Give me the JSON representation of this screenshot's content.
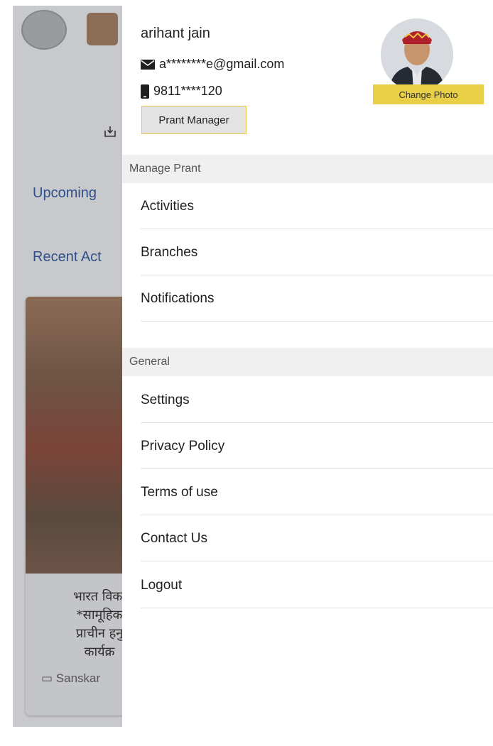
{
  "background": {
    "upcoming_label": "Upcoming",
    "recent_label": "Recent Act",
    "card_text": "भारत विका\n*सामूहिक\nप्राचीन हनु\nकार्यक्र",
    "card_meta": "Sanskar"
  },
  "drawer": {
    "profile": {
      "name": "arihant jain",
      "email": "a********e@gmail.com",
      "phone": "9811****120",
      "role_button": "Prant Manager",
      "change_photo": "Change Photo"
    },
    "sections": [
      {
        "title": "Manage Prant",
        "items": [
          "Activities",
          "Branches",
          "Notifications"
        ]
      },
      {
        "title": "General",
        "items": [
          "Settings",
          "Privacy Policy",
          "Terms of use",
          "Contact Us",
          "Logout"
        ]
      }
    ]
  },
  "colors": {
    "accent_yellow": "#e9cf46",
    "link_blue": "#2f4e8a",
    "section_bg": "#f0f0f0"
  }
}
